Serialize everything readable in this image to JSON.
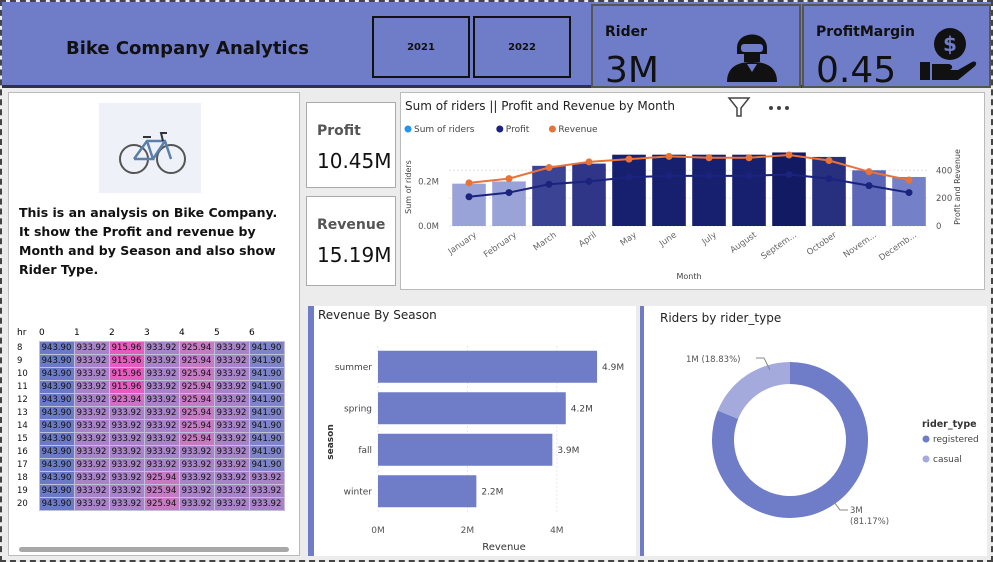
{
  "header": {
    "title": "Bike Company Analytics",
    "years": [
      "2021",
      "2022"
    ],
    "rider_label": "Rider",
    "rider_value": "3M",
    "margin_label": "ProfitMargin",
    "margin_value": "0.45"
  },
  "side": {
    "description": "This is an analysis on Bike Company. It show the Profit and revenue by Month and by Season and also show Rider Type.",
    "heatmap": {
      "corner": "hr",
      "cols": [
        "0",
        "1",
        "2",
        "3",
        "4",
        "5",
        "6"
      ],
      "rows": [
        {
          "hr": "8",
          "v": [
            "943.90",
            "933.92",
            "915.96",
            "933.92",
            "925.94",
            "933.92",
            "941.90"
          ]
        },
        {
          "hr": "9",
          "v": [
            "943.90",
            "933.92",
            "915.96",
            "933.92",
            "925.94",
            "933.92",
            "941.90"
          ]
        },
        {
          "hr": "10",
          "v": [
            "943.90",
            "933.92",
            "915.96",
            "933.92",
            "925.94",
            "933.92",
            "941.90"
          ]
        },
        {
          "hr": "11",
          "v": [
            "943.90",
            "933.92",
            "915.96",
            "933.92",
            "925.94",
            "933.92",
            "941.90"
          ]
        },
        {
          "hr": "12",
          "v": [
            "943.90",
            "933.92",
            "923.94",
            "933.92",
            "925.94",
            "933.92",
            "941.90"
          ]
        },
        {
          "hr": "13",
          "v": [
            "943.90",
            "933.92",
            "933.92",
            "933.92",
            "925.94",
            "933.92",
            "941.90"
          ]
        },
        {
          "hr": "14",
          "v": [
            "943.90",
            "933.92",
            "933.92",
            "933.92",
            "925.94",
            "933.92",
            "941.90"
          ]
        },
        {
          "hr": "15",
          "v": [
            "943.90",
            "933.92",
            "933.92",
            "933.92",
            "925.94",
            "933.92",
            "941.90"
          ]
        },
        {
          "hr": "16",
          "v": [
            "943.90",
            "933.92",
            "933.92",
            "933.92",
            "933.92",
            "933.92",
            "941.90"
          ]
        },
        {
          "hr": "17",
          "v": [
            "943.90",
            "933.92",
            "933.92",
            "933.92",
            "933.92",
            "933.92",
            "941.90"
          ]
        },
        {
          "hr": "18",
          "v": [
            "943.90",
            "933.92",
            "933.92",
            "925.94",
            "933.92",
            "933.92",
            "933.92"
          ]
        },
        {
          "hr": "19",
          "v": [
            "943.90",
            "933.92",
            "933.92",
            "925.94",
            "933.92",
            "933.92",
            "933.92"
          ]
        },
        {
          "hr": "20",
          "v": [
            "943.90",
            "933.92",
            "933.92",
            "925.94",
            "933.92",
            "933.92",
            "933.92"
          ]
        }
      ]
    }
  },
  "kpis": {
    "profit_label": "Profit",
    "profit_value": "10.45M",
    "revenue_label": "Revenue",
    "revenue_value": "15.19M"
  },
  "colors": {
    "accent": "#6f7cc8",
    "profit": "#1a237e",
    "revenue": "#e8733a",
    "riders": "#2196f3"
  },
  "chart_data": [
    {
      "type": "bar",
      "title": "Sum of riders || Profit and Revenue by Month",
      "legend": [
        "Sum of riders",
        "Profit",
        "Revenue"
      ],
      "xlabel": "Month",
      "ylabel": "Sum of riders",
      "y2label": "Profit and Revenue",
      "yticks": [
        "0.0M",
        "0.2M"
      ],
      "y2ticks": [
        "0",
        "200",
        "400"
      ],
      "ylim": [
        0,
        0.35
      ],
      "y2lim": [
        0,
        560
      ],
      "categories": [
        "January",
        "February",
        "March",
        "April",
        "May",
        "June",
        "July",
        "August",
        "Septem...",
        "October",
        "Novem...",
        "Decemb..."
      ],
      "series": [
        {
          "name": "Sum of riders",
          "values": [
            0.19,
            0.2,
            0.27,
            0.28,
            0.32,
            0.32,
            0.32,
            0.32,
            0.33,
            0.31,
            0.25,
            0.22
          ]
        },
        {
          "name": "Profit",
          "values": [
            210,
            240,
            300,
            320,
            350,
            360,
            360,
            360,
            370,
            340,
            290,
            240
          ]
        },
        {
          "name": "Revenue",
          "values": [
            310,
            340,
            420,
            460,
            480,
            500,
            490,
            490,
            510,
            470,
            390,
            330
          ]
        }
      ]
    },
    {
      "type": "bar",
      "title": "Revenue By Season",
      "xlabel": "Revenue",
      "ylabel": "season",
      "xticks": [
        "0M",
        "2M",
        "4M"
      ],
      "xlim": [
        0,
        5.1
      ],
      "categories": [
        "summer",
        "spring",
        "fall",
        "winter"
      ],
      "values": [
        4.9,
        4.2,
        3.9,
        2.2
      ],
      "labels": [
        "4.9M",
        "4.2M",
        "3.9M",
        "2.2M"
      ]
    },
    {
      "type": "pie",
      "title": "Riders by rider_type",
      "legend_title": "rider_type",
      "slices": [
        {
          "name": "registered",
          "value": 81.17,
          "label_top": "3M",
          "label_bottom": "(81.17%)"
        },
        {
          "name": "casual",
          "value": 18.83,
          "label": "1M (18.83%)"
        }
      ]
    }
  ]
}
